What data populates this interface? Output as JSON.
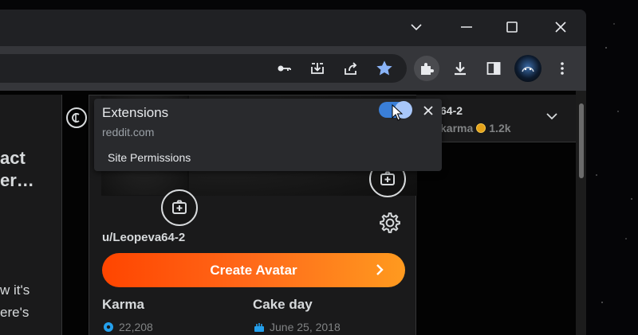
{
  "window": {
    "controls": [
      "minimize",
      "maximize",
      "close"
    ]
  },
  "toolbar": {
    "icons": [
      "key-icon",
      "install-icon",
      "share-icon",
      "bookmark-star-icon",
      "extensions-puzzle-icon",
      "download-icon",
      "side-panel-icon",
      "profile-avatar",
      "more-menu-icon"
    ]
  },
  "extensions_popup": {
    "title": "Extensions",
    "site": "reddit.com",
    "permissions_label": "Site Permissions",
    "toggle_on": true
  },
  "left_panel": {
    "heading_lines": [
      "act",
      "er…"
    ],
    "text_lines": [
      "w it's",
      "ere's"
    ]
  },
  "profile": {
    "username": "u/Leopeva64-2",
    "create_avatar_label": "Create Avatar",
    "karma_label": "Karma",
    "karma_value": "22,208",
    "cake_day_label": "Cake day",
    "cake_day_value": "June 25, 2018"
  },
  "user_menu": {
    "name_partial": "64-2",
    "karma_partial": "karma",
    "coins": "1.2k"
  },
  "colors": {
    "accent_toggle": "#3a7fd8",
    "create_avatar_start": "#ff4500",
    "create_avatar_end": "#ff9a1f",
    "star": "#8ab4f8"
  }
}
